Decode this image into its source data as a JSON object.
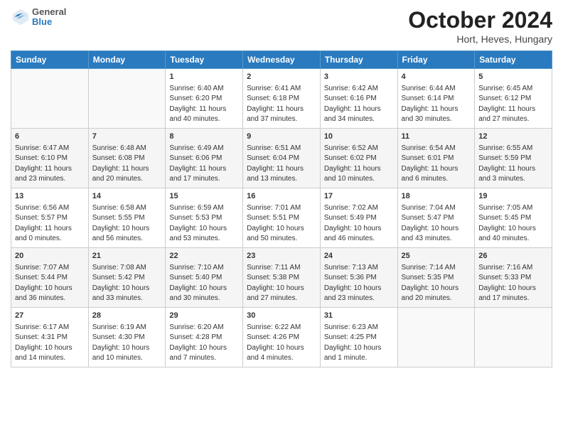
{
  "header": {
    "logo_general": "General",
    "logo_blue": "Blue",
    "title": "October 2024",
    "subtitle": "Hort, Heves, Hungary"
  },
  "columns": [
    "Sunday",
    "Monday",
    "Tuesday",
    "Wednesday",
    "Thursday",
    "Friday",
    "Saturday"
  ],
  "weeks": [
    [
      {
        "day": "",
        "info": ""
      },
      {
        "day": "",
        "info": ""
      },
      {
        "day": "1",
        "info": "Sunrise: 6:40 AM\nSunset: 6:20 PM\nDaylight: 11 hours and 40 minutes."
      },
      {
        "day": "2",
        "info": "Sunrise: 6:41 AM\nSunset: 6:18 PM\nDaylight: 11 hours and 37 minutes."
      },
      {
        "day": "3",
        "info": "Sunrise: 6:42 AM\nSunset: 6:16 PM\nDaylight: 11 hours and 34 minutes."
      },
      {
        "day": "4",
        "info": "Sunrise: 6:44 AM\nSunset: 6:14 PM\nDaylight: 11 hours and 30 minutes."
      },
      {
        "day": "5",
        "info": "Sunrise: 6:45 AM\nSunset: 6:12 PM\nDaylight: 11 hours and 27 minutes."
      }
    ],
    [
      {
        "day": "6",
        "info": "Sunrise: 6:47 AM\nSunset: 6:10 PM\nDaylight: 11 hours and 23 minutes."
      },
      {
        "day": "7",
        "info": "Sunrise: 6:48 AM\nSunset: 6:08 PM\nDaylight: 11 hours and 20 minutes."
      },
      {
        "day": "8",
        "info": "Sunrise: 6:49 AM\nSunset: 6:06 PM\nDaylight: 11 hours and 17 minutes."
      },
      {
        "day": "9",
        "info": "Sunrise: 6:51 AM\nSunset: 6:04 PM\nDaylight: 11 hours and 13 minutes."
      },
      {
        "day": "10",
        "info": "Sunrise: 6:52 AM\nSunset: 6:02 PM\nDaylight: 11 hours and 10 minutes."
      },
      {
        "day": "11",
        "info": "Sunrise: 6:54 AM\nSunset: 6:01 PM\nDaylight: 11 hours and 6 minutes."
      },
      {
        "day": "12",
        "info": "Sunrise: 6:55 AM\nSunset: 5:59 PM\nDaylight: 11 hours and 3 minutes."
      }
    ],
    [
      {
        "day": "13",
        "info": "Sunrise: 6:56 AM\nSunset: 5:57 PM\nDaylight: 11 hours and 0 minutes."
      },
      {
        "day": "14",
        "info": "Sunrise: 6:58 AM\nSunset: 5:55 PM\nDaylight: 10 hours and 56 minutes."
      },
      {
        "day": "15",
        "info": "Sunrise: 6:59 AM\nSunset: 5:53 PM\nDaylight: 10 hours and 53 minutes."
      },
      {
        "day": "16",
        "info": "Sunrise: 7:01 AM\nSunset: 5:51 PM\nDaylight: 10 hours and 50 minutes."
      },
      {
        "day": "17",
        "info": "Sunrise: 7:02 AM\nSunset: 5:49 PM\nDaylight: 10 hours and 46 minutes."
      },
      {
        "day": "18",
        "info": "Sunrise: 7:04 AM\nSunset: 5:47 PM\nDaylight: 10 hours and 43 minutes."
      },
      {
        "day": "19",
        "info": "Sunrise: 7:05 AM\nSunset: 5:45 PM\nDaylight: 10 hours and 40 minutes."
      }
    ],
    [
      {
        "day": "20",
        "info": "Sunrise: 7:07 AM\nSunset: 5:44 PM\nDaylight: 10 hours and 36 minutes."
      },
      {
        "day": "21",
        "info": "Sunrise: 7:08 AM\nSunset: 5:42 PM\nDaylight: 10 hours and 33 minutes."
      },
      {
        "day": "22",
        "info": "Sunrise: 7:10 AM\nSunset: 5:40 PM\nDaylight: 10 hours and 30 minutes."
      },
      {
        "day": "23",
        "info": "Sunrise: 7:11 AM\nSunset: 5:38 PM\nDaylight: 10 hours and 27 minutes."
      },
      {
        "day": "24",
        "info": "Sunrise: 7:13 AM\nSunset: 5:36 PM\nDaylight: 10 hours and 23 minutes."
      },
      {
        "day": "25",
        "info": "Sunrise: 7:14 AM\nSunset: 5:35 PM\nDaylight: 10 hours and 20 minutes."
      },
      {
        "day": "26",
        "info": "Sunrise: 7:16 AM\nSunset: 5:33 PM\nDaylight: 10 hours and 17 minutes."
      }
    ],
    [
      {
        "day": "27",
        "info": "Sunrise: 6:17 AM\nSunset: 4:31 PM\nDaylight: 10 hours and 14 minutes."
      },
      {
        "day": "28",
        "info": "Sunrise: 6:19 AM\nSunset: 4:30 PM\nDaylight: 10 hours and 10 minutes."
      },
      {
        "day": "29",
        "info": "Sunrise: 6:20 AM\nSunset: 4:28 PM\nDaylight: 10 hours and 7 minutes."
      },
      {
        "day": "30",
        "info": "Sunrise: 6:22 AM\nSunset: 4:26 PM\nDaylight: 10 hours and 4 minutes."
      },
      {
        "day": "31",
        "info": "Sunrise: 6:23 AM\nSunset: 4:25 PM\nDaylight: 10 hours and 1 minute."
      },
      {
        "day": "",
        "info": ""
      },
      {
        "day": "",
        "info": ""
      }
    ]
  ]
}
